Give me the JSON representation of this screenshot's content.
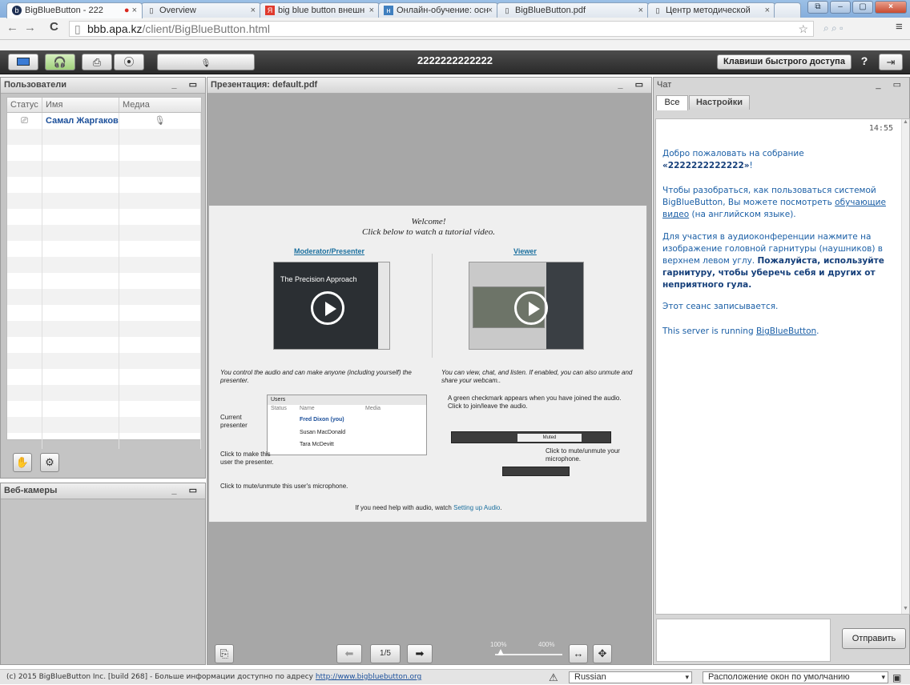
{
  "browser": {
    "tabs": [
      {
        "title": "BigBlueButton - 222",
        "icon": "bbb-icon"
      },
      {
        "title": "Overview",
        "icon": "page-icon"
      },
      {
        "title": "big blue button внешн",
        "icon": "yandex-icon"
      },
      {
        "title": "Онлайн-обучение: осн",
        "icon": "site-icon"
      },
      {
        "title": "BigBlueButton.pdf",
        "icon": "page-icon"
      },
      {
        "title": "Центр методической",
        "icon": "page-icon"
      }
    ],
    "url_host": "bbb.apa.kz",
    "url_path": "/client/BigBlueButton.html"
  },
  "toolbar": {
    "meeting_title": "2222222222222",
    "shortcuts_label": "Клавиши быстрого доступа",
    "help_label": "?"
  },
  "users_panel": {
    "title": "Пользователи",
    "columns": [
      "Статус",
      "Имя",
      "Медиа"
    ],
    "rows": [
      {
        "name": "Самал Жаргакова ("
      }
    ]
  },
  "webcams_panel": {
    "title": "Веб-камеры"
  },
  "presentation": {
    "title": "Презентация: default.pdf",
    "page": "1/5",
    "zoom_min": "100%",
    "zoom_max": "400%",
    "slide": {
      "welcome": "Welcome!",
      "subtitle": "Click below to watch a tutorial video.",
      "moderator_link": "Moderator/Presenter",
      "viewer_link": "Viewer",
      "video_caption": "The Precision Approach",
      "mod_text": "You control the audio and can make anyone (including yourself) the presenter.",
      "viewer_text": "You can view, chat, and listen.  If enabled, you can also unmute and share your webcam..",
      "mini_title": "Users",
      "mini_cols": [
        "Status",
        "Name",
        "Media"
      ],
      "mini_rows": [
        "Fred Dixon (you)",
        "Susan MacDonald",
        "Tara McDevitt"
      ],
      "current_presenter": "Current presenter",
      "click_make": "Click to make this user the presenter.",
      "click_mute_user": "Click to mute/unmute this user's microphone.",
      "green_check": "A green checkmark appears when you have joined the audio.  Click to join/leave the audio.",
      "muted": "Muted",
      "click_mute_your": "Click to mute/unmute your microphone.",
      "help_prefix": "If you need help with audio, watch ",
      "help_link": "Setting up Audio",
      "help_suffix": "."
    }
  },
  "chat_panel": {
    "title": "Чат",
    "tabs": [
      "Все",
      "Настройки"
    ],
    "time": "14:55",
    "msg1_prefix": "Добро пожаловать на собрание ",
    "msg1_bold": "«2222222222222»",
    "msg1_suffix": "!",
    "msg2_prefix": "Чтобы разобраться, как пользоваться системой BigBlueButton, Вы можете посмотреть ",
    "msg2_link": "обучающие видео",
    "msg2_suffix": " (на английском языке).",
    "msg3_prefix": "Для участия в аудиоконференции нажмите на изображение головной гарнитуры (наушников) в верхнем левом углу. ",
    "msg3_bold": "Пожалуйста, используйте гарнитуру, чтобы уберечь себя и других от неприятного гула.",
    "msg4": "Этот сеанс записывается.",
    "msg5_prefix": "This server is running ",
    "msg5_link": "BigBlueButton",
    "msg5_suffix": ".",
    "send_label": "Отправить"
  },
  "footer": {
    "copyright": "(c) 2015 BigBlueButton Inc. [build 268] - Больше информации доступно по адресу ",
    "link": "http://www.bigbluebutton.org",
    "language": "Russian",
    "layout": "Расположение окон по умолчанию"
  }
}
